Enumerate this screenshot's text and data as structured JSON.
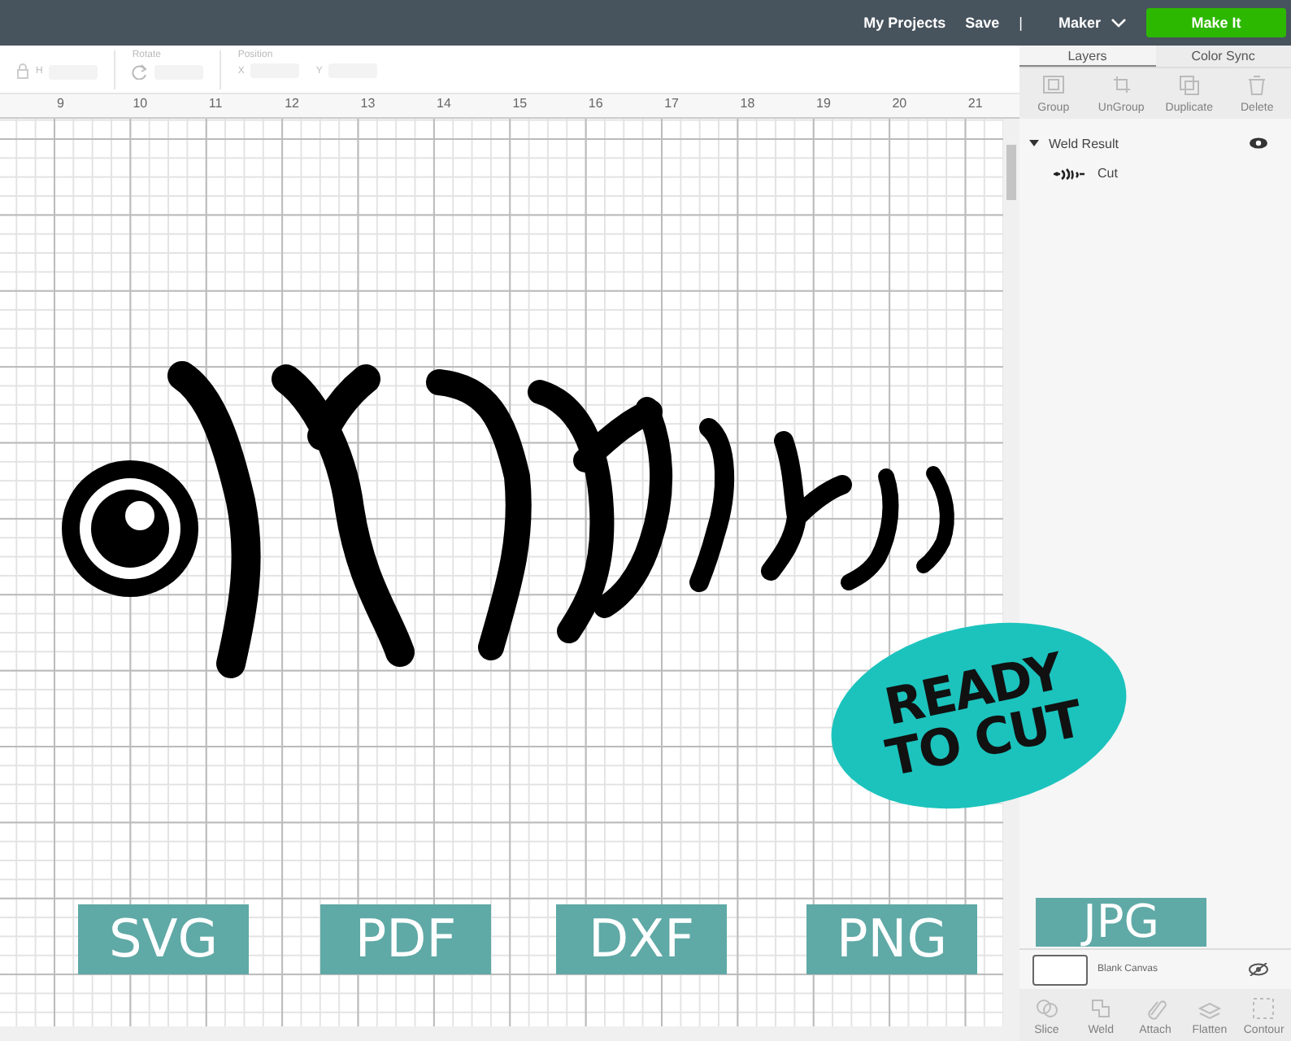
{
  "header": {
    "links": [
      "My Projects",
      "Save"
    ],
    "separator": "|",
    "machine": "Maker",
    "make_button": "Make It"
  },
  "toolbar": {
    "height_label": "H",
    "rotate_label": "Rotate",
    "position_label": "Position",
    "x_label": "X",
    "y_label": "Y"
  },
  "ruler": [
    "9",
    "10",
    "11",
    "12",
    "13",
    "14",
    "15",
    "16",
    "17",
    "18",
    "19",
    "20",
    "21"
  ],
  "panel": {
    "tabs": [
      {
        "label": "Layers",
        "selected": true
      },
      {
        "label": "Color Sync",
        "selected": false
      }
    ],
    "actions": [
      {
        "kind": "group",
        "label": "Group"
      },
      {
        "kind": "ungroup",
        "label": "UnGroup"
      },
      {
        "kind": "duplicate",
        "label": "Duplicate"
      },
      {
        "kind": "delete",
        "label": "Delete"
      }
    ],
    "layers": [
      {
        "name": "Weld Result",
        "expanded": true,
        "visible": true,
        "children": [
          {
            "name": "Cut"
          }
        ]
      }
    ],
    "blank_canvas": {
      "label": "Blank Canvas",
      "visible": false
    },
    "bottom_actions": [
      {
        "kind": "slice",
        "label": "Slice"
      },
      {
        "kind": "weld",
        "label": "Weld"
      },
      {
        "kind": "attach",
        "label": "Attach"
      },
      {
        "kind": "flatten",
        "label": "Flatten"
      },
      {
        "kind": "contour",
        "label": "Contour"
      }
    ]
  },
  "badge": {
    "lines": [
      "READY",
      "TO CUT"
    ]
  },
  "formats": [
    "SVG",
    "PDF",
    "DXF",
    "PNG",
    "JPG"
  ]
}
